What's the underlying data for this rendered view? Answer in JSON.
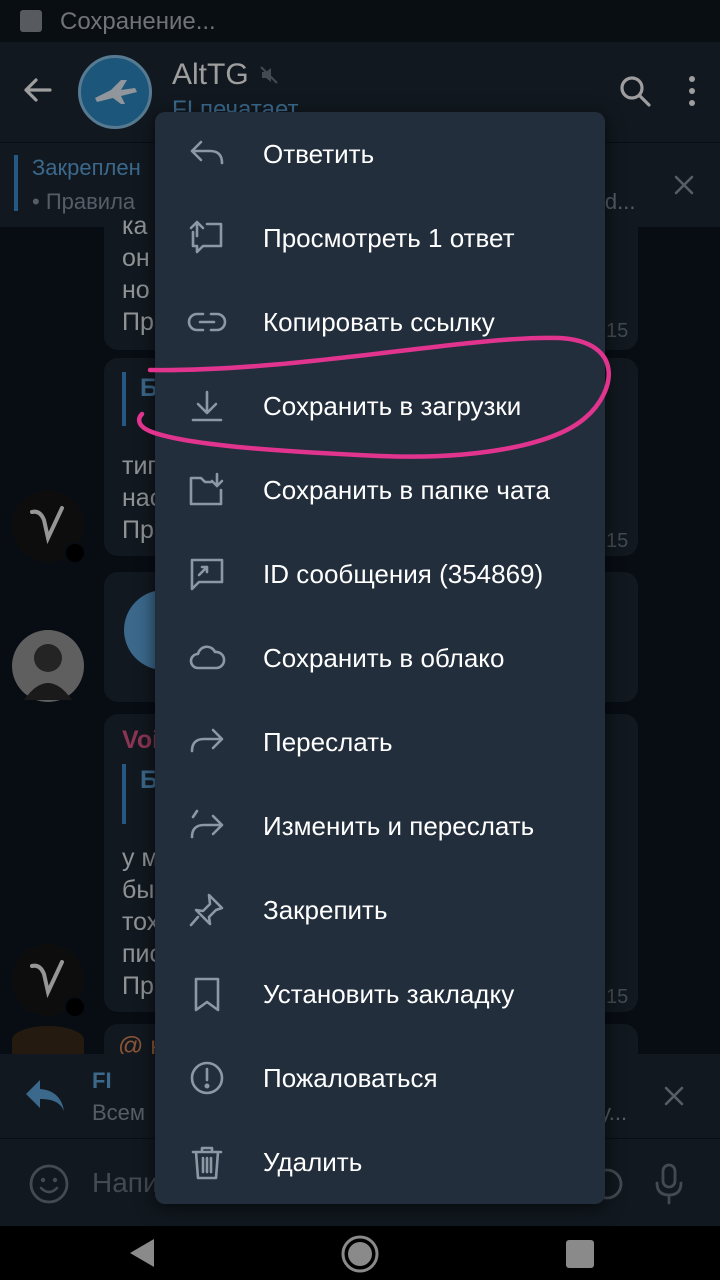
{
  "status_bar": {
    "text": "Сохранение..."
  },
  "header": {
    "title": "AltTG",
    "typing": "FI печатает"
  },
  "pinned": {
    "title": "Закреплен",
    "text": "• Правила",
    "tail": "id..."
  },
  "chat": {
    "msg1_lines": [
      "ка",
      "он",
      "но",
      "Пр"
    ],
    "msg1_time": "15",
    "msg2_quote": "Б",
    "msg2_lines": [
      "тип",
      "нас",
      "Пр"
    ],
    "msg2_time": "15",
    "msg3_sender": "Voi",
    "msg3_quote": "Б",
    "msg3_lines": [
      "у м",
      "бы",
      "тох",
      "пис",
      "Пр"
    ],
    "msg3_time": "15",
    "msg4_partial": "@ к"
  },
  "reply_bar": {
    "name": "FI",
    "text": "Всем",
    "tail": "у..."
  },
  "input": {
    "placeholder": "Напи"
  },
  "menu": {
    "items": [
      {
        "label": "Ответить",
        "icon": "reply-icon"
      },
      {
        "label": "Просмотреть 1 ответ",
        "icon": "view-replies-icon"
      },
      {
        "label": "Копировать ссылку",
        "icon": "link-icon"
      },
      {
        "label": "Сохранить в загрузки",
        "icon": "download-icon"
      },
      {
        "label": "Сохранить в папке чата",
        "icon": "folder-download-icon"
      },
      {
        "label": "ID сообщения (354869)",
        "icon": "message-id-icon"
      },
      {
        "label": "Сохранить в облако",
        "icon": "cloud-icon"
      },
      {
        "label": "Переслать",
        "icon": "forward-icon"
      },
      {
        "label": "Изменить и переслать",
        "icon": "edit-forward-icon"
      },
      {
        "label": "Закрепить",
        "icon": "pin-icon"
      },
      {
        "label": "Установить закладку",
        "icon": "bookmark-icon"
      },
      {
        "label": "Пожаловаться",
        "icon": "report-icon"
      },
      {
        "label": "Удалить",
        "icon": "delete-icon"
      }
    ]
  },
  "colors": {
    "accent": "#5fa8e0",
    "highlight": "#e0348f",
    "menu_bg": "#222e3b"
  }
}
